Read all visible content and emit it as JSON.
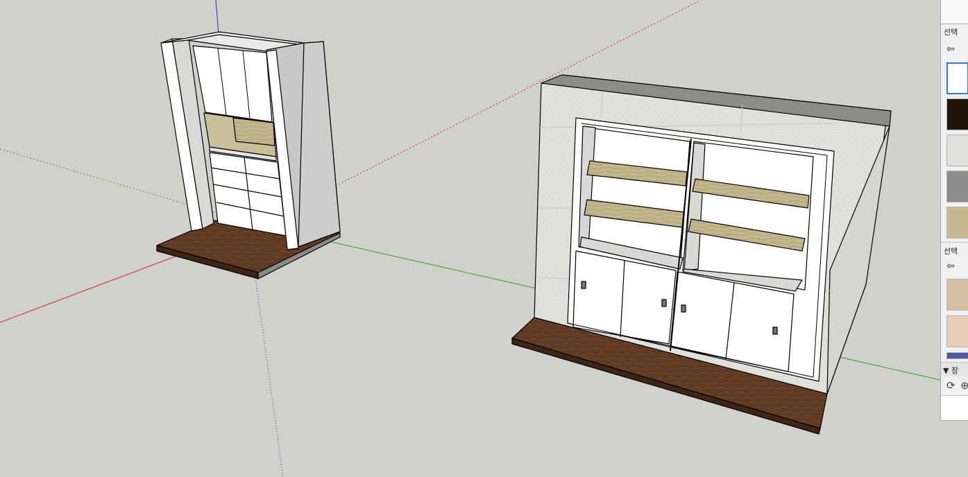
{
  "viewport": {
    "axis_colors": {
      "red": "#d42323",
      "green": "#23a623",
      "blue": "#2323c8"
    },
    "background": "#d1d1cc"
  },
  "materials_panel": {
    "select_tab_label": "선택",
    "back_icon": "back-arrow-icon",
    "swatches": [
      {
        "name": "white",
        "color": "#ffffff"
      },
      {
        "name": "dark-wood",
        "color": "#1e140c"
      },
      {
        "name": "light-stone",
        "color": "#e0e0da"
      },
      {
        "name": "gray",
        "color": "#8c8c8c"
      },
      {
        "name": "oak",
        "color": "#c8b890"
      }
    ]
  },
  "secondary_panel": {
    "select_tab_label": "선택",
    "back_icon": "back-arrow-icon",
    "swatches": [
      {
        "name": "tan",
        "color": "#d4c0a0"
      },
      {
        "name": "light-wood",
        "color": "#e8cdb8"
      },
      {
        "name": "blue",
        "color": "#4a5aa0"
      }
    ]
  },
  "scenes_panel": {
    "header_label": "▼ 장",
    "refresh_icon": "refresh-icon",
    "add_icon": "add-icon"
  }
}
